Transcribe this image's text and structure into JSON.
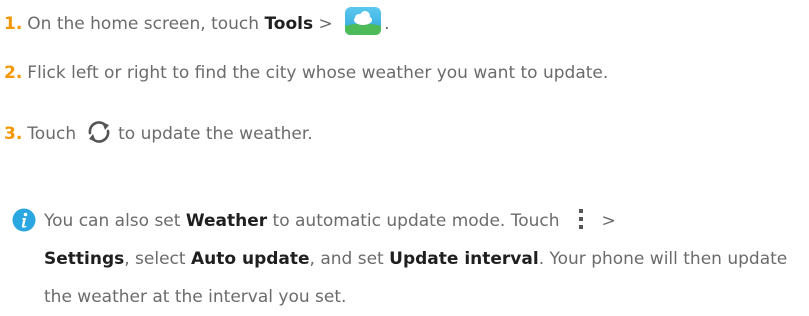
{
  "steps": [
    {
      "number": "1.",
      "text_a": "On the home screen, touch ",
      "bold_a": "Tools",
      "text_b": " > ",
      "icon": "weather-app-icon",
      "text_c": "."
    },
    {
      "number": "2.",
      "text_a": "Flick left or right to find the city whose weather you want to update."
    },
    {
      "number": "3.",
      "text_a": "Touch",
      "icon": "refresh-icon",
      "text_b": "to update the weather."
    }
  ],
  "note": {
    "icon": "info-icon",
    "t1": "You can also set ",
    "b1": "Weather",
    "t2": " to automatic update mode. Touch",
    "more_icon": "more-vertical-icon",
    "t3": ">",
    "b2": "Settings",
    "t4": ", select ",
    "b3": "Auto update",
    "t5": ", and set ",
    "b4": "Update interval",
    "t6": ". Your phone will then update the weather at the interval you set."
  },
  "colors": {
    "step_number": "#f39800",
    "body_text": "#6b6b6b",
    "bold_text": "#1f1f1f",
    "info_icon": "#2aa7e0",
    "weather_icon_bg": "#3dbbe6",
    "weather_icon_ground": "#4dbb5a"
  }
}
